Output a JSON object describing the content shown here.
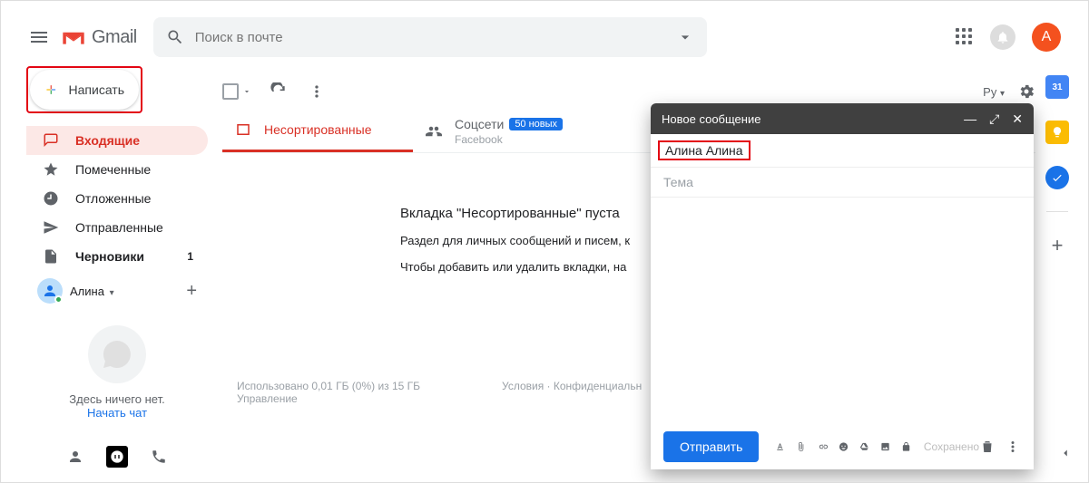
{
  "header": {
    "logo_text": "Gmail",
    "search_placeholder": "Поиск в почте",
    "avatar_letter": "А"
  },
  "compose_button": {
    "label": "Написать"
  },
  "nav": {
    "inbox": "Входящие",
    "starred": "Помеченные",
    "snoozed": "Отложенные",
    "sent": "Отправленные",
    "drafts": "Черновики",
    "drafts_count": "1"
  },
  "user": {
    "name": "Алина"
  },
  "hangouts": {
    "empty": "Здесь ничего нет.",
    "start": "Начать чат"
  },
  "toolbar": {
    "lang": "Ру"
  },
  "cats": {
    "primary": "Несортированные",
    "social": "Соцсети",
    "social_badge": "50 новых",
    "social_sub": "Facebook"
  },
  "empty": {
    "l1": "Вкладка \"Несортированные\" пуста",
    "l2": "Раздел для личных сообщений и писем, к",
    "l3": "Чтобы добавить или удалить вкладки, на"
  },
  "footer": {
    "storage": "Использовано 0,01 ГБ (0%) из 15 ГБ",
    "manage": "Управление",
    "terms": "Условия",
    "privacy": "Конфиденциальн"
  },
  "sidepanel": {
    "cal": "31"
  },
  "compose_window": {
    "title": "Новое сообщение",
    "to": "Алина Алина",
    "subject_placeholder": "Тема",
    "send": "Отправить",
    "saved": "Сохранено"
  }
}
